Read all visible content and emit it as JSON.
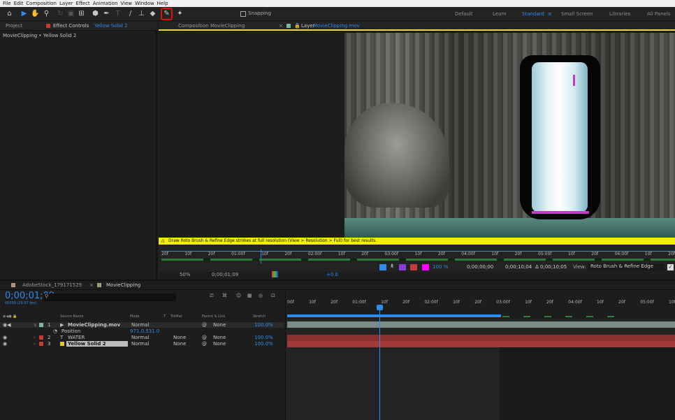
{
  "menu": [
    "File",
    "Edit",
    "Composition",
    "Layer",
    "Effect",
    "Animation",
    "View",
    "Window",
    "Help"
  ],
  "toolbar": {
    "snapping": "Snapping"
  },
  "workspaces": [
    "Default",
    "Learn",
    "Standard",
    "Small Screen",
    "Libraries",
    "All Panels"
  ],
  "left_panel": {
    "tab_project": "Project",
    "tab_effects": "Effect Controls",
    "effects_layer": "Yellow Solid 2",
    "breadcrumb": "MovieClipping • Yellow Solid 2"
  },
  "viewer": {
    "tab_composition": "Composition MovieClipping",
    "tab_layer": "Layer",
    "layer_name": "MovieClipping.mov",
    "warning": "Draw Roto Brush & Refine Edge strokes at full resolution (View > Resolution > Full) for best results.",
    "ruler": [
      "20f",
      "10f",
      "20f",
      "01:00f",
      "10f",
      "20f",
      "02:00f",
      "10f",
      "20f",
      "03:00f",
      "10f",
      "20f",
      "04:00f",
      "10f",
      "20f",
      "05:00f",
      "10f",
      "20f",
      "06:00f",
      "10f",
      "20f"
    ],
    "percent": "100 %",
    "start": "0;00;00;00",
    "end": "0;00;10;04",
    "duration": "Δ 0;00;10;05",
    "view_label": "View:",
    "view_value": "Roto Brush & Refine Edge",
    "zoom": "50%",
    "timecode": "0;00;01;09",
    "exposure": "+0.0"
  },
  "timeline": {
    "tab1": "AdobeStock_179171529",
    "tab2": "MovieClipping",
    "timecode": "0;00;01;09",
    "fps": "00039 (29.97 fps)",
    "cols": {
      "source": "Source Name",
      "mode": "Mode",
      "t": "T",
      "trkmat": "TrkMat",
      "parent": "Parent & Link",
      "stretch": "Stretch"
    },
    "layers": [
      {
        "num": "1",
        "name": "MovieClipping.mov",
        "mode": "Normal",
        "trkmat": "",
        "parent": "None",
        "stretch": "100.0%",
        "color": "#7fb3a8"
      },
      {
        "num": "2",
        "name": "WATER",
        "mode": "Normal",
        "trkmat": "None",
        "parent": "None",
        "stretch": "100.0%",
        "color": "#c63a3a"
      },
      {
        "num": "3",
        "name": "Yellow Solid 2",
        "mode": "Normal",
        "trkmat": "None",
        "parent": "None",
        "stretch": "100.0%",
        "color": "#c63a3a"
      }
    ],
    "position_label": "Position",
    "position_value": "971.0,531.0",
    "ruler": [
      "00f",
      "10f",
      "20f",
      "01:00f",
      "10f",
      "20f",
      "02:00f",
      "10f",
      "20f",
      "03:00f",
      "10f",
      "20f",
      "04:00f",
      "10f",
      "20f",
      "05:00f",
      "10f"
    ]
  }
}
